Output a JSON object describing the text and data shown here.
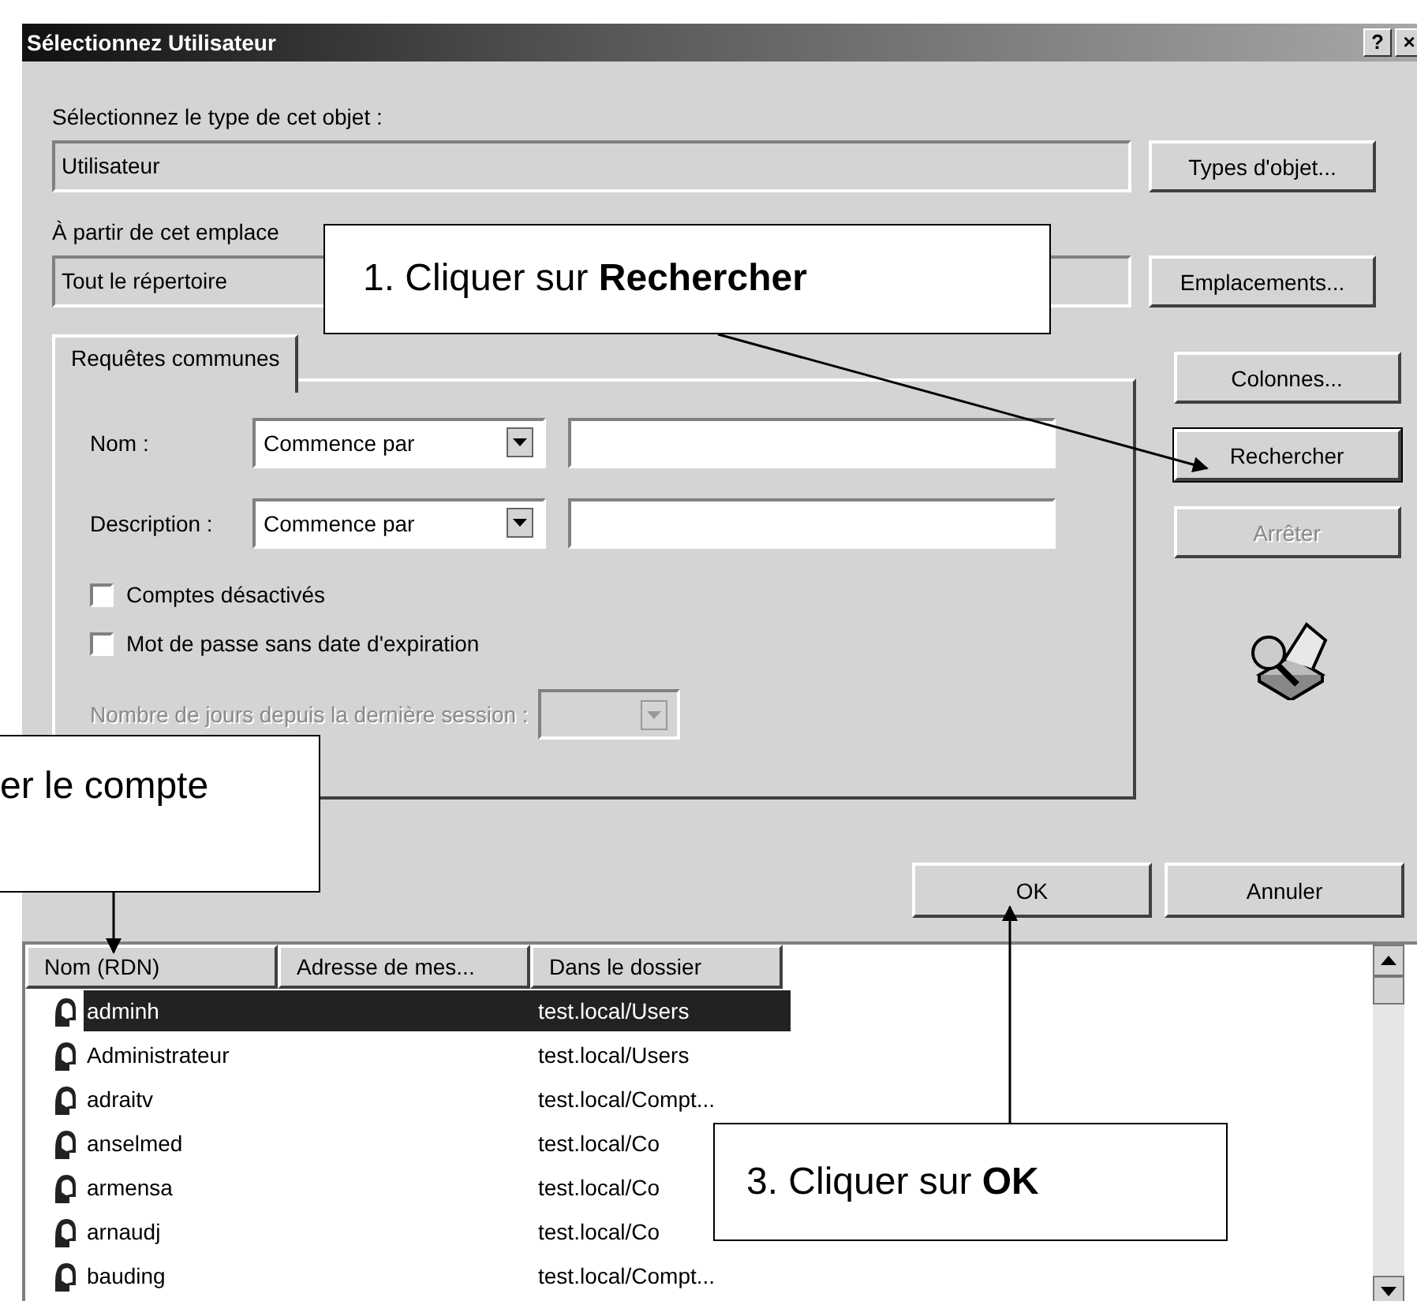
{
  "window": {
    "title": "Sélectionnez Utilisateur",
    "buttons": [
      "?",
      "×"
    ]
  },
  "object_type": {
    "label": "Sélectionnez le type de cet objet :",
    "value": "Utilisateur",
    "button": "Types d'objet..."
  },
  "location": {
    "label": "À partir de cet emplace",
    "value": "Tout le répertoire",
    "button": "Emplacements..."
  },
  "tabs": [
    {
      "label": "Requêtes communes",
      "selected": true
    }
  ],
  "query": {
    "fields": [
      {
        "label": "Nom :",
        "mode": "Commence par"
      },
      {
        "label": "Description :",
        "mode": "Commence par"
      }
    ],
    "checks": [
      {
        "label": "Comptes désactivés",
        "checked": false
      },
      {
        "label": "Mot de passe sans date d'expiration",
        "checked": false
      }
    ],
    "days": {
      "label": "Nombre de jours depuis la dernière session :",
      "disabled": true
    }
  },
  "side_buttons": [
    {
      "label": "Colonnes...",
      "default": false,
      "disabled": false
    },
    {
      "label": "Rechercher",
      "default": true,
      "disabled": false
    },
    {
      "label": "Arrêter",
      "default": false,
      "disabled": true
    }
  ],
  "dialog_buttons": [
    "OK",
    "Annuler"
  ],
  "results": {
    "columns": [
      "Nom (RDN)",
      "Adresse de mes...",
      "Dans le dossier"
    ],
    "rows": [
      {
        "name": "adminh",
        "folder": "test.local/Users",
        "selected": true
      },
      {
        "name": "Administrateur",
        "folder": "test.local/Users",
        "selected": false
      },
      {
        "name": "adraitv",
        "folder": "test.local/Compt...",
        "selected": false
      },
      {
        "name": "anselmed",
        "folder": "test.local/Co",
        "selected": false
      },
      {
        "name": "armensa",
        "folder": "test.local/Co",
        "selected": false
      },
      {
        "name": "arnaudj",
        "folder": "test.local/Co",
        "selected": false
      },
      {
        "name": "bauding",
        "folder": "test.local/Compt...",
        "selected": false
      }
    ]
  },
  "callouts": [
    {
      "text": "1. Cliquer sur **Rechercher**"
    },
    {
      "text": "er le compte"
    },
    {
      "text": "3. Cliquer sur **OK**"
    }
  ]
}
